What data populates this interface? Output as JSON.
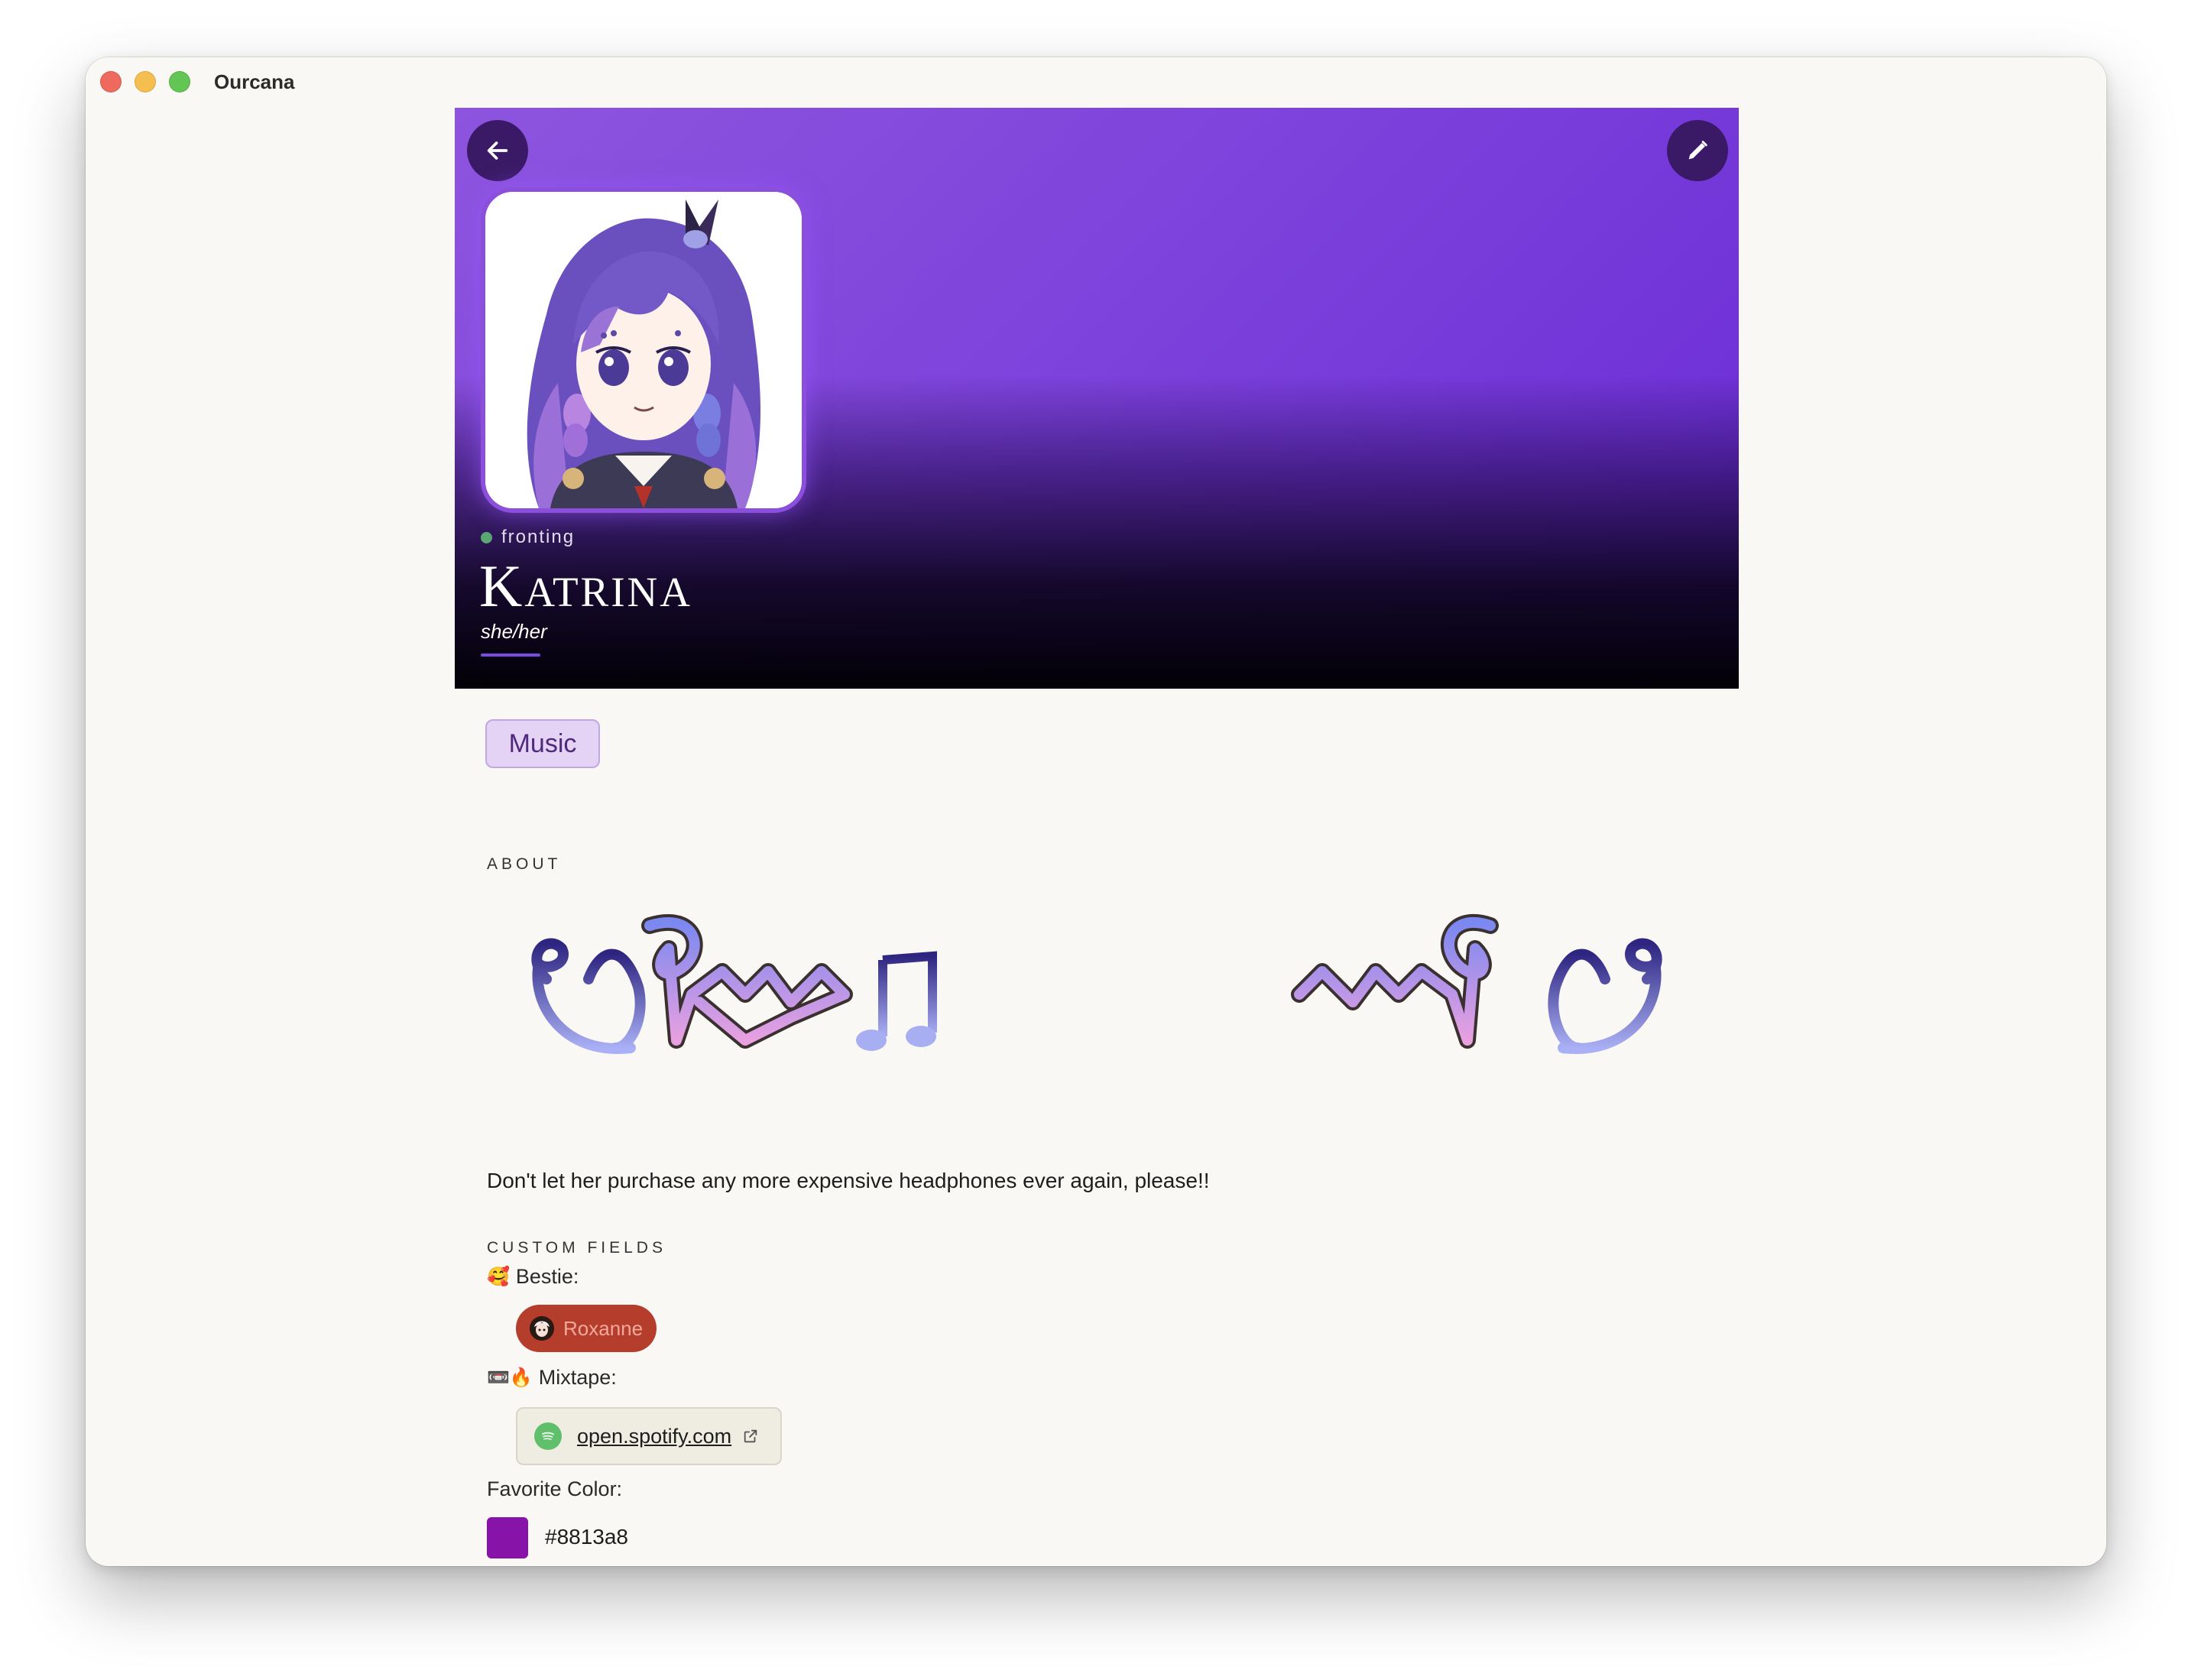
{
  "window": {
    "title": "Ourcana"
  },
  "profile": {
    "status": "fronting",
    "name": "Katrina",
    "pronouns": "she/her",
    "tag": "Music"
  },
  "about": {
    "label": "ABOUT",
    "text": "Don't let her purchase any more expensive headphones ever again, please!!"
  },
  "custom_fields": {
    "label": "CUSTOM FIELDS",
    "bestie": {
      "emoji": "🥰",
      "label": "Bestie:",
      "value": "Roxanne"
    },
    "mixtape": {
      "emoji": "📼🔥",
      "label": "Mixtape:",
      "link": "open.spotify.com"
    },
    "favorite_color": {
      "label": "Favorite Color:",
      "value": "#8813a8"
    }
  },
  "colors": {
    "hero_purple": "#7a3fdb",
    "accent": "#8813a8",
    "tag_bg": "#e4d3f5",
    "bestie_pill": "#b53d2c",
    "status_green": "#5aa774"
  },
  "icons": {
    "back": "arrow-left-icon",
    "edit": "pencil-icon",
    "external": "external-link-icon",
    "spotify": "spotify-icon"
  }
}
